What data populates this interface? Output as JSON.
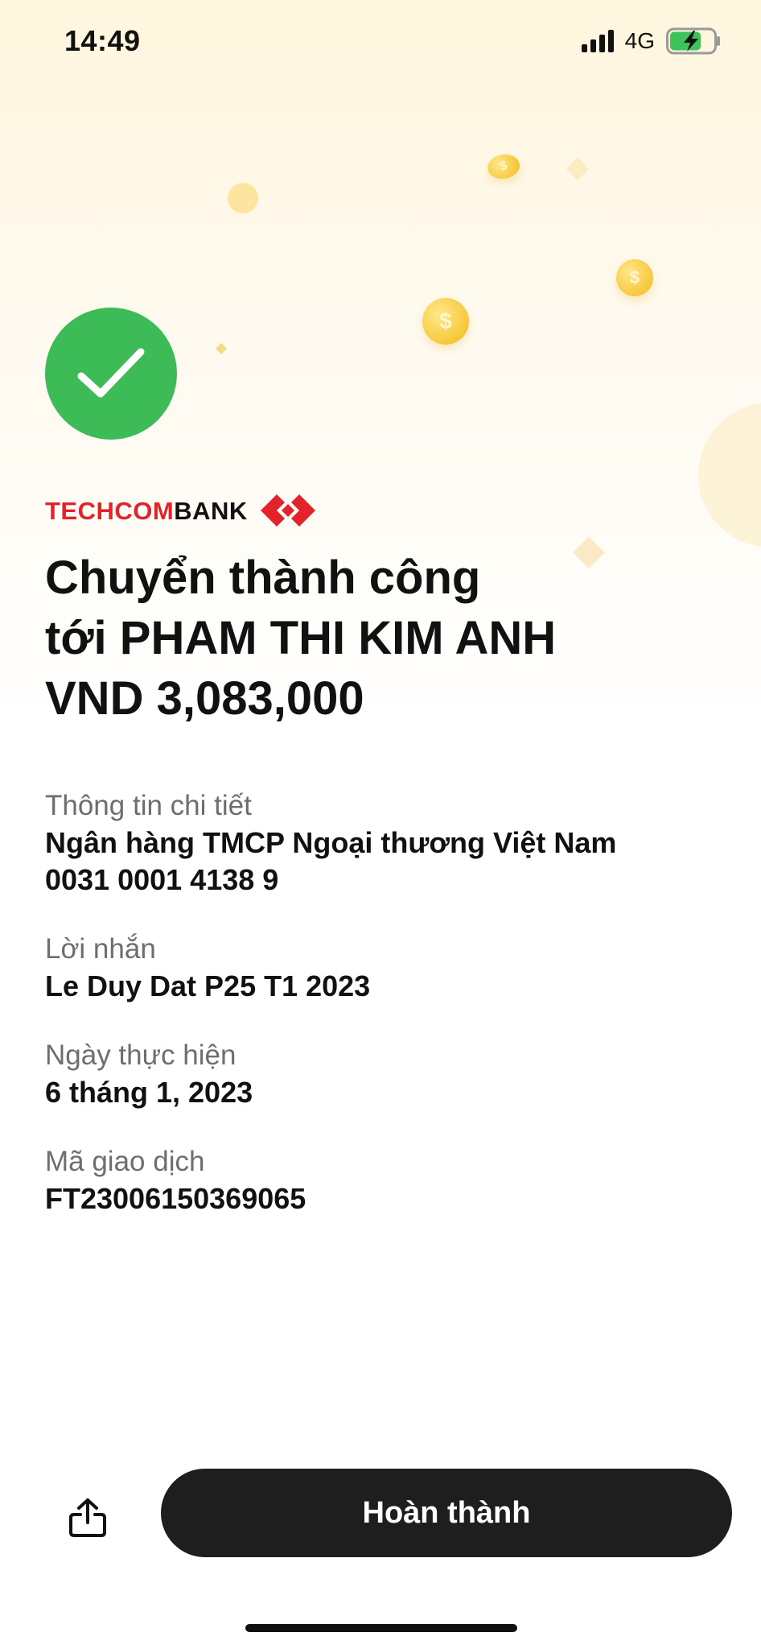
{
  "status_bar": {
    "time": "14:49",
    "network": "4G",
    "battery_charging": true
  },
  "brand": {
    "name_part1": "TECHCOM",
    "name_part2": "BANK",
    "logo_icon": "techcombank-logo-icon",
    "brand_red": "#e3232c"
  },
  "success": {
    "icon": "checkmark-icon",
    "color": "#3dbb57"
  },
  "headline": {
    "line1": "Chuyển thành công",
    "line2": "tới PHAM THI KIM ANH",
    "line3": "VND 3,083,000"
  },
  "details": {
    "info_label": "Thông tin chi tiết",
    "bank_name": "Ngân hàng TMCP Ngoại thương Việt Nam",
    "account_number": "0031 0001 4138 9",
    "message_label": "Lời nhắn",
    "message_value": "Le Duy Dat P25 T1 2023",
    "date_label": "Ngày thực hiện",
    "date_value": "6 tháng 1, 2023",
    "transaction_label": "Mã giao dịch",
    "transaction_value": "FT23006150369065"
  },
  "actions": {
    "share_icon": "share-icon",
    "done_label": "Hoàn thành"
  }
}
